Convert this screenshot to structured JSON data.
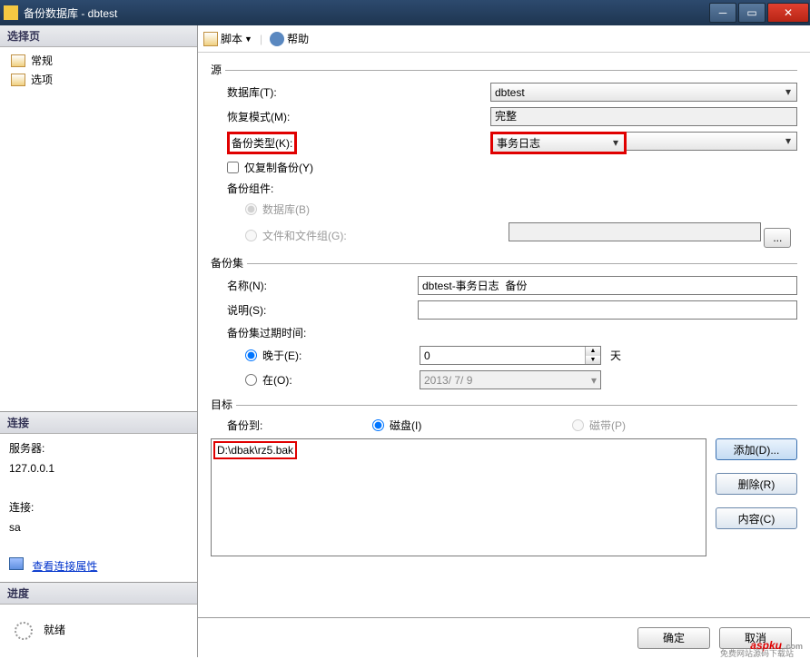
{
  "window": {
    "title": "备份数据库 - dbtest"
  },
  "sidebar": {
    "select_page": "选择页",
    "general": "常规",
    "options": "选项",
    "connection_header": "连接",
    "server_label": "服务器:",
    "server_value": "127.0.0.1",
    "conn_label": "连接:",
    "conn_value": "sa",
    "view_props": "查看连接属性",
    "progress_header": "进度",
    "ready": "就绪"
  },
  "toolbar": {
    "script": "脚本",
    "help": "帮助"
  },
  "form": {
    "source_group": "源",
    "database_label": "数据库(T):",
    "database_value": "dbtest",
    "recovery_label": "恢复模式(M):",
    "recovery_value": "完整",
    "backup_type_label": "备份类型(K):",
    "backup_type_value": "事务日志",
    "copy_only": "仅复制备份(Y)",
    "backup_component": "备份组件:",
    "comp_db": "数据库(B)",
    "comp_files": "文件和文件组(G):",
    "backup_set_group": "备份集",
    "name_label": "名称(N):",
    "name_value": "dbtest-事务日志  备份",
    "desc_label": "说明(S):",
    "desc_value": "",
    "expire_label": "备份集过期时间:",
    "after_label": "晚于(E):",
    "after_value": "0",
    "days_label": "天",
    "on_label": "在(O):",
    "on_value": "2013/ 7/ 9",
    "dest_group": "目标",
    "backup_to": "备份到:",
    "disk": "磁盘(I)",
    "tape": "磁带(P)",
    "dest_path": "D:\\dbak\\rz5.bak",
    "add_btn": "添加(D)...",
    "remove_btn": "删除(R)",
    "contents_btn": "内容(C)"
  },
  "buttons": {
    "ok": "确定",
    "cancel": "取消"
  },
  "watermark": {
    "brand": "aspku",
    "dom": ".com",
    "tag": "免费网站源码下载站"
  }
}
